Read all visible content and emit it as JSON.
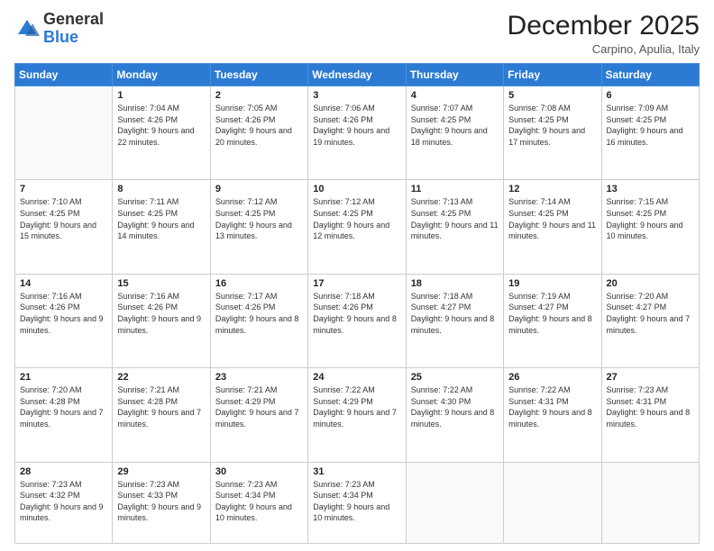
{
  "header": {
    "logo_general": "General",
    "logo_blue": "Blue",
    "month_title": "December 2025",
    "location": "Carpino, Apulia, Italy"
  },
  "days_of_week": [
    "Sunday",
    "Monday",
    "Tuesday",
    "Wednesday",
    "Thursday",
    "Friday",
    "Saturday"
  ],
  "weeks": [
    [
      {
        "day": "",
        "sunrise": "",
        "sunset": "",
        "daylight": ""
      },
      {
        "day": "1",
        "sunrise": "Sunrise: 7:04 AM",
        "sunset": "Sunset: 4:26 PM",
        "daylight": "Daylight: 9 hours and 22 minutes."
      },
      {
        "day": "2",
        "sunrise": "Sunrise: 7:05 AM",
        "sunset": "Sunset: 4:26 PM",
        "daylight": "Daylight: 9 hours and 20 minutes."
      },
      {
        "day": "3",
        "sunrise": "Sunrise: 7:06 AM",
        "sunset": "Sunset: 4:26 PM",
        "daylight": "Daylight: 9 hours and 19 minutes."
      },
      {
        "day": "4",
        "sunrise": "Sunrise: 7:07 AM",
        "sunset": "Sunset: 4:25 PM",
        "daylight": "Daylight: 9 hours and 18 minutes."
      },
      {
        "day": "5",
        "sunrise": "Sunrise: 7:08 AM",
        "sunset": "Sunset: 4:25 PM",
        "daylight": "Daylight: 9 hours and 17 minutes."
      },
      {
        "day": "6",
        "sunrise": "Sunrise: 7:09 AM",
        "sunset": "Sunset: 4:25 PM",
        "daylight": "Daylight: 9 hours and 16 minutes."
      }
    ],
    [
      {
        "day": "7",
        "sunrise": "Sunrise: 7:10 AM",
        "sunset": "Sunset: 4:25 PM",
        "daylight": "Daylight: 9 hours and 15 minutes."
      },
      {
        "day": "8",
        "sunrise": "Sunrise: 7:11 AM",
        "sunset": "Sunset: 4:25 PM",
        "daylight": "Daylight: 9 hours and 14 minutes."
      },
      {
        "day": "9",
        "sunrise": "Sunrise: 7:12 AM",
        "sunset": "Sunset: 4:25 PM",
        "daylight": "Daylight: 9 hours and 13 minutes."
      },
      {
        "day": "10",
        "sunrise": "Sunrise: 7:12 AM",
        "sunset": "Sunset: 4:25 PM",
        "daylight": "Daylight: 9 hours and 12 minutes."
      },
      {
        "day": "11",
        "sunrise": "Sunrise: 7:13 AM",
        "sunset": "Sunset: 4:25 PM",
        "daylight": "Daylight: 9 hours and 11 minutes."
      },
      {
        "day": "12",
        "sunrise": "Sunrise: 7:14 AM",
        "sunset": "Sunset: 4:25 PM",
        "daylight": "Daylight: 9 hours and 11 minutes."
      },
      {
        "day": "13",
        "sunrise": "Sunrise: 7:15 AM",
        "sunset": "Sunset: 4:25 PM",
        "daylight": "Daylight: 9 hours and 10 minutes."
      }
    ],
    [
      {
        "day": "14",
        "sunrise": "Sunrise: 7:16 AM",
        "sunset": "Sunset: 4:26 PM",
        "daylight": "Daylight: 9 hours and 9 minutes."
      },
      {
        "day": "15",
        "sunrise": "Sunrise: 7:16 AM",
        "sunset": "Sunset: 4:26 PM",
        "daylight": "Daylight: 9 hours and 9 minutes."
      },
      {
        "day": "16",
        "sunrise": "Sunrise: 7:17 AM",
        "sunset": "Sunset: 4:26 PM",
        "daylight": "Daylight: 9 hours and 8 minutes."
      },
      {
        "day": "17",
        "sunrise": "Sunrise: 7:18 AM",
        "sunset": "Sunset: 4:26 PM",
        "daylight": "Daylight: 9 hours and 8 minutes."
      },
      {
        "day": "18",
        "sunrise": "Sunrise: 7:18 AM",
        "sunset": "Sunset: 4:27 PM",
        "daylight": "Daylight: 9 hours and 8 minutes."
      },
      {
        "day": "19",
        "sunrise": "Sunrise: 7:19 AM",
        "sunset": "Sunset: 4:27 PM",
        "daylight": "Daylight: 9 hours and 8 minutes."
      },
      {
        "day": "20",
        "sunrise": "Sunrise: 7:20 AM",
        "sunset": "Sunset: 4:27 PM",
        "daylight": "Daylight: 9 hours and 7 minutes."
      }
    ],
    [
      {
        "day": "21",
        "sunrise": "Sunrise: 7:20 AM",
        "sunset": "Sunset: 4:28 PM",
        "daylight": "Daylight: 9 hours and 7 minutes."
      },
      {
        "day": "22",
        "sunrise": "Sunrise: 7:21 AM",
        "sunset": "Sunset: 4:28 PM",
        "daylight": "Daylight: 9 hours and 7 minutes."
      },
      {
        "day": "23",
        "sunrise": "Sunrise: 7:21 AM",
        "sunset": "Sunset: 4:29 PM",
        "daylight": "Daylight: 9 hours and 7 minutes."
      },
      {
        "day": "24",
        "sunrise": "Sunrise: 7:22 AM",
        "sunset": "Sunset: 4:29 PM",
        "daylight": "Daylight: 9 hours and 7 minutes."
      },
      {
        "day": "25",
        "sunrise": "Sunrise: 7:22 AM",
        "sunset": "Sunset: 4:30 PM",
        "daylight": "Daylight: 9 hours and 8 minutes."
      },
      {
        "day": "26",
        "sunrise": "Sunrise: 7:22 AM",
        "sunset": "Sunset: 4:31 PM",
        "daylight": "Daylight: 9 hours and 8 minutes."
      },
      {
        "day": "27",
        "sunrise": "Sunrise: 7:23 AM",
        "sunset": "Sunset: 4:31 PM",
        "daylight": "Daylight: 9 hours and 8 minutes."
      }
    ],
    [
      {
        "day": "28",
        "sunrise": "Sunrise: 7:23 AM",
        "sunset": "Sunset: 4:32 PM",
        "daylight": "Daylight: 9 hours and 9 minutes."
      },
      {
        "day": "29",
        "sunrise": "Sunrise: 7:23 AM",
        "sunset": "Sunset: 4:33 PM",
        "daylight": "Daylight: 9 hours and 9 minutes."
      },
      {
        "day": "30",
        "sunrise": "Sunrise: 7:23 AM",
        "sunset": "Sunset: 4:34 PM",
        "daylight": "Daylight: 9 hours and 10 minutes."
      },
      {
        "day": "31",
        "sunrise": "Sunrise: 7:23 AM",
        "sunset": "Sunset: 4:34 PM",
        "daylight": "Daylight: 9 hours and 10 minutes."
      },
      {
        "day": "",
        "sunrise": "",
        "sunset": "",
        "daylight": ""
      },
      {
        "day": "",
        "sunrise": "",
        "sunset": "",
        "daylight": ""
      },
      {
        "day": "",
        "sunrise": "",
        "sunset": "",
        "daylight": ""
      }
    ]
  ]
}
